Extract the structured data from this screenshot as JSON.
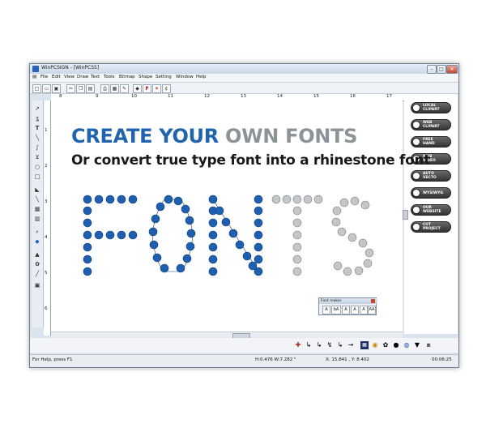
{
  "window": {
    "title": "WinPCSIGN - [WinPCS5]",
    "controls": {
      "minimize": "–",
      "maximize": "□",
      "close": "✕"
    }
  },
  "menu": [
    "File",
    "Edit",
    "View",
    "Draw",
    "Text",
    "Tools",
    "Bitmap",
    "Shape",
    "Setting",
    "Window",
    "Help"
  ],
  "ruler": {
    "h_ticks": [
      "8",
      "9",
      "10",
      "11",
      "12",
      "13",
      "14",
      "15",
      "16",
      "17"
    ],
    "v_ticks": [
      "1",
      "2",
      "3",
      "4",
      "5",
      "6",
      "7",
      "8"
    ]
  },
  "canvas": {
    "headline_blue": "CREATE YOUR",
    "headline_gray": "OWN FONTS",
    "subline": "Or convert true type font into a rhinestone font",
    "colors": {
      "blue": "#1f64ad",
      "gray": "#8c9397",
      "dot_blue": "#1f5fb0",
      "dot_gray": "#c4c7c9"
    }
  },
  "right_panel": [
    {
      "label": "LOCAL\nCLIPART",
      "icon": "folder-icon"
    },
    {
      "label": "WEB\nCLIPART",
      "icon": "globe-icon"
    },
    {
      "label": "FREE\nHAND",
      "icon": "hand-icon"
    },
    {
      "label": "WEB\nVIDEO",
      "icon": "video-icon"
    },
    {
      "label": "AUTO\nVECTO",
      "icon": "wand-icon"
    },
    {
      "label": "WYSIWYG",
      "icon": "eye-icon"
    },
    {
      "label": "OUR\nWEBSITE",
      "icon": "web-icon"
    },
    {
      "label": "CUT\nPROJECT",
      "icon": "scissors-icon"
    }
  ],
  "font_maker": {
    "title": "Font maker",
    "buttons": [
      "A",
      "bA",
      "A",
      "A",
      "A",
      "AA"
    ]
  },
  "status": {
    "help": "For Help, press F1",
    "hw": "H:0.476  W:7.282 \"",
    "xy": "X: 15.841 , Y: 8.402",
    "time": "00:06:25"
  }
}
